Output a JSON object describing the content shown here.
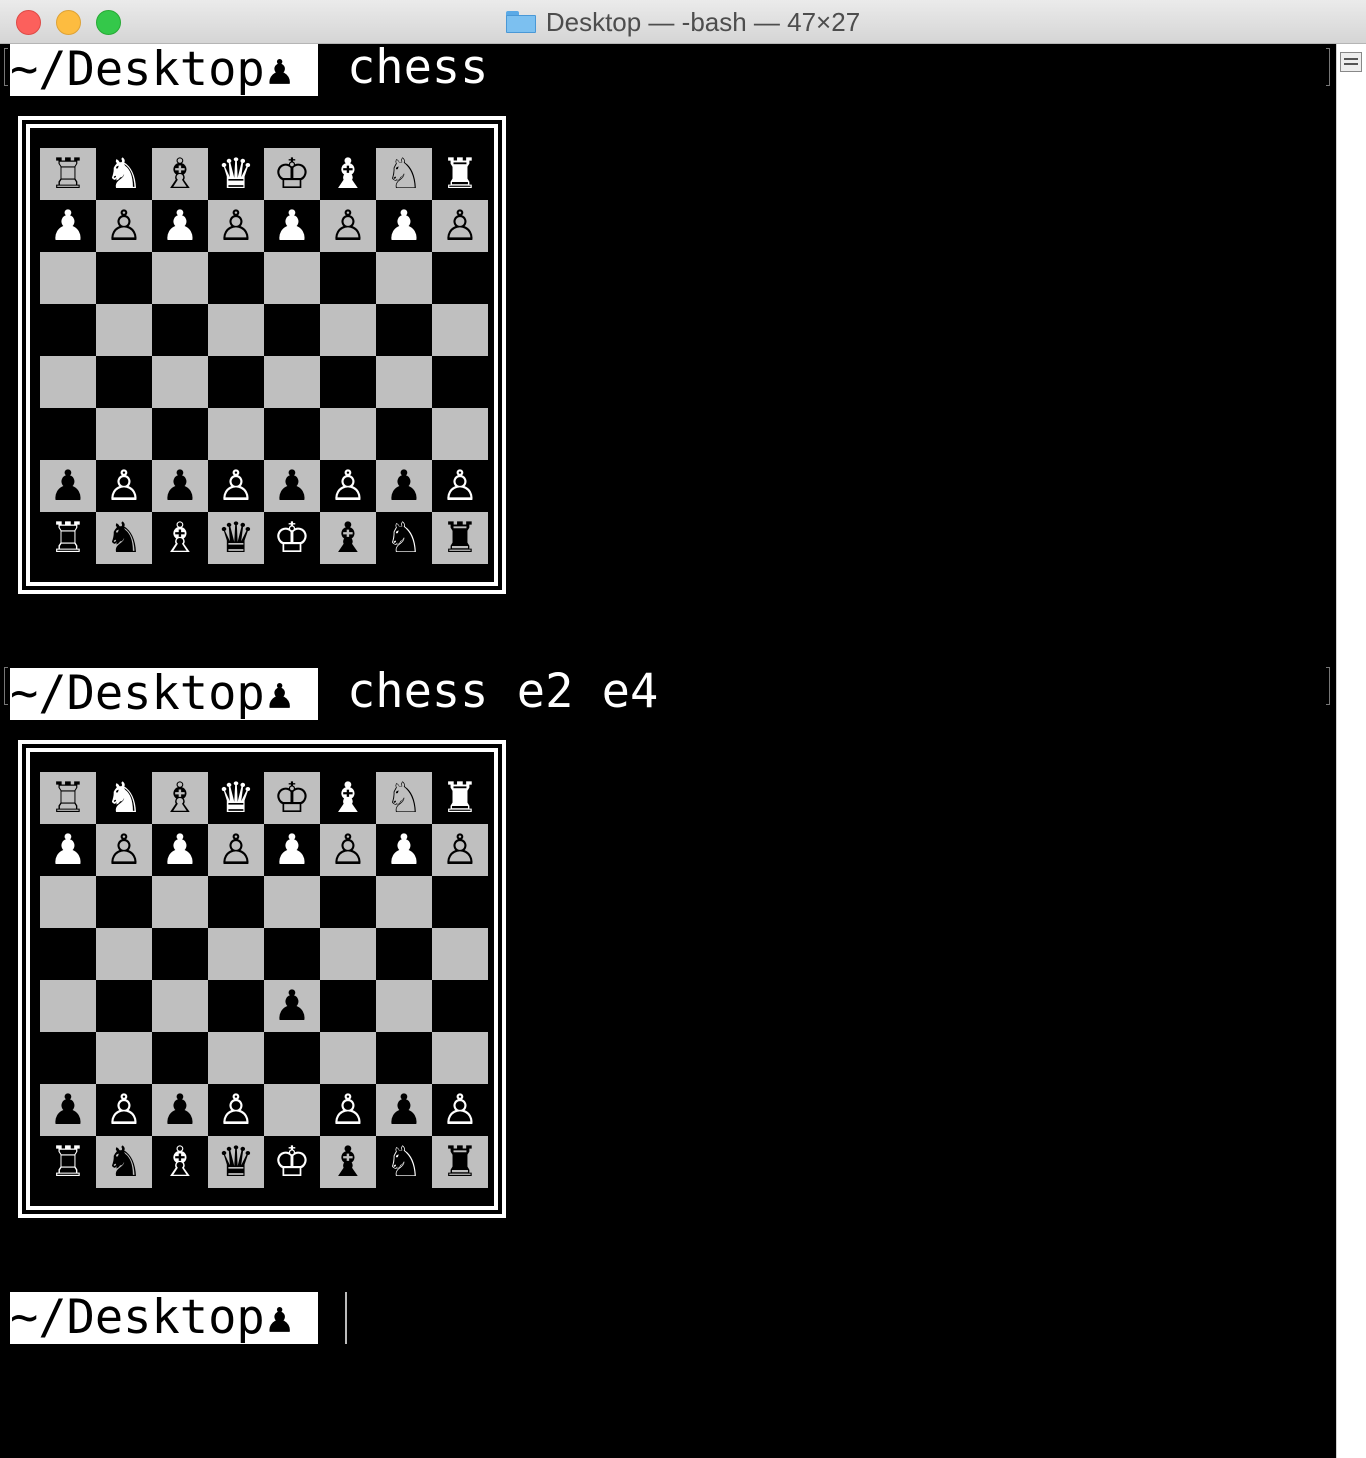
{
  "window": {
    "title": "Desktop — -bash — 47×27",
    "folder_icon": "folder-icon"
  },
  "colors": {
    "light_square": "#bfbfbf",
    "dark_square": "#000000",
    "prompt_background": "#ffffff",
    "terminal_background": "#000000"
  },
  "session": {
    "prompt_text": "~/Desktop",
    "prompt_symbol": "♟",
    "commands": [
      {
        "text": "chess"
      },
      {
        "text": "chess e2 e4"
      }
    ]
  },
  "boards": [
    {
      "rows": [
        [
          "♖",
          "♞",
          "♗",
          "♛",
          "♔",
          "♝",
          "♘",
          "♜"
        ],
        [
          "♟",
          "♙",
          "♟",
          "♙",
          "♟",
          "♙",
          "♟",
          "♙"
        ],
        [
          "",
          "",
          "",
          "",
          "",
          "",
          "",
          ""
        ],
        [
          "",
          "",
          "",
          "",
          "",
          "",
          "",
          ""
        ],
        [
          "",
          "",
          "",
          "",
          "",
          "",
          "",
          ""
        ],
        [
          "",
          "",
          "",
          "",
          "",
          "",
          "",
          ""
        ],
        [
          "♟",
          "♙",
          "♟",
          "♙",
          "♟",
          "♙",
          "♟",
          "♙"
        ],
        [
          "♖",
          "♞",
          "♗",
          "♛",
          "♔",
          "♝",
          "♘",
          "♜"
        ]
      ]
    },
    {
      "rows": [
        [
          "♖",
          "♞",
          "♗",
          "♛",
          "♔",
          "♝",
          "♘",
          "♜"
        ],
        [
          "♟",
          "♙",
          "♟",
          "♙",
          "♟",
          "♙",
          "♟",
          "♙"
        ],
        [
          "",
          "",
          "",
          "",
          "",
          "",
          "",
          ""
        ],
        [
          "",
          "",
          "",
          "",
          "",
          "",
          "",
          ""
        ],
        [
          "",
          "",
          "",
          "",
          "♟",
          "",
          "",
          ""
        ],
        [
          "",
          "",
          "",
          "",
          "",
          "",
          "",
          ""
        ],
        [
          "♟",
          "♙",
          "♟",
          "♙",
          "",
          "♙",
          "♟",
          "♙"
        ],
        [
          "♖",
          "♞",
          "♗",
          "♛",
          "♔",
          "♝",
          "♘",
          "♜"
        ]
      ]
    }
  ]
}
